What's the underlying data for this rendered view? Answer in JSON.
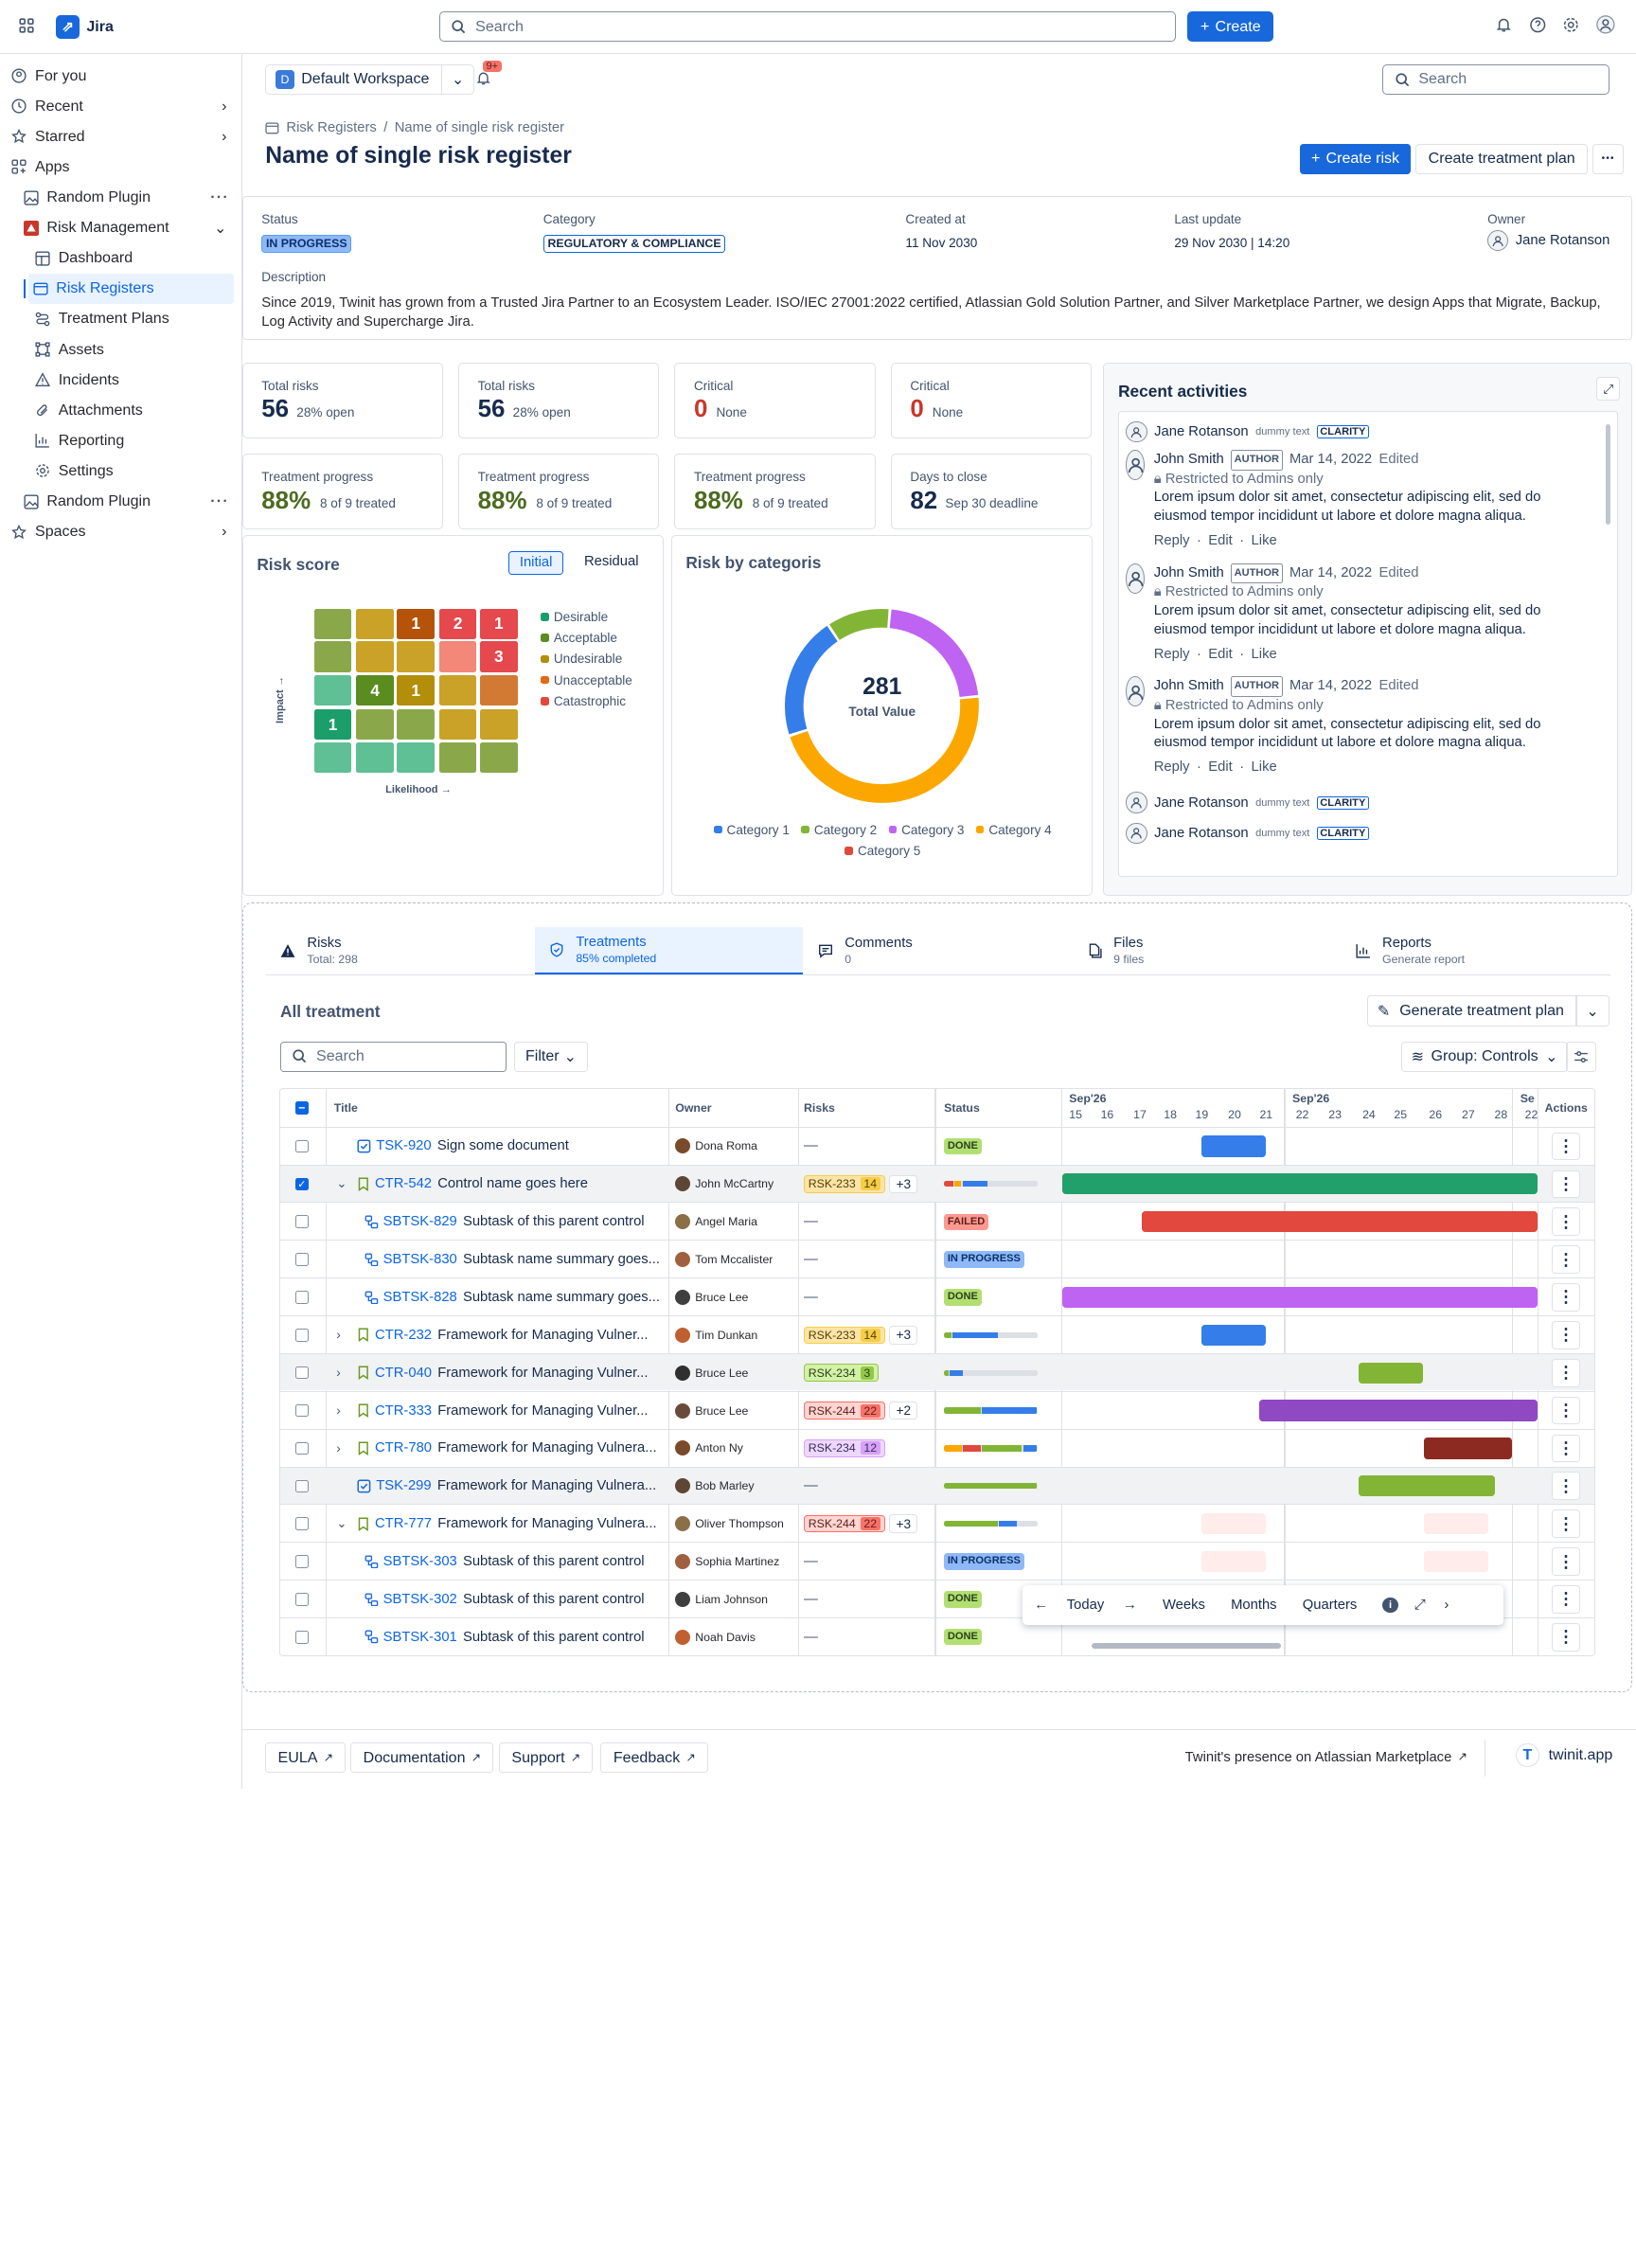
{
  "topbar": {
    "app_name": "Jira",
    "search_placeholder": "Search",
    "create_label": "Create"
  },
  "sidebar": {
    "items": [
      {
        "label": "For you"
      },
      {
        "label": "Recent"
      },
      {
        "label": "Starred"
      },
      {
        "label": "Apps"
      },
      {
        "label": "Random Plugin"
      },
      {
        "label": "Risk Management"
      },
      {
        "label": "Dashboard"
      },
      {
        "label": "Risk Registers"
      },
      {
        "label": "Treatment Plans"
      },
      {
        "label": "Assets"
      },
      {
        "label": "Incidents"
      },
      {
        "label": "Attachments"
      },
      {
        "label": "Reporting"
      },
      {
        "label": "Settings"
      },
      {
        "label": "Random Plugin"
      },
      {
        "label": "Spaces"
      }
    ]
  },
  "workspace": {
    "letter": "D",
    "name": "Default Workspace",
    "notif_badge": "9+",
    "search_placeholder": "Search"
  },
  "breadcrumb": {
    "root": "Risk Registers",
    "sep": "/",
    "current": "Name of single risk register"
  },
  "page": {
    "title": "Name of single risk register",
    "create_risk": "Create risk",
    "create_plan": "Create treatment plan",
    "more": "•••"
  },
  "details": {
    "status_label": "Status",
    "status": "IN PROGRESS",
    "category_label": "Category",
    "category": "REGULATORY & COMPLIANCE",
    "created_label": "Created at",
    "created": "11 Nov 2030",
    "updated_label": "Last update",
    "updated": "29 Nov 2030 | 14:20",
    "owner_label": "Owner",
    "owner": "Jane Rotanson",
    "desc_label": "Description",
    "desc": "Since 2019, Twinit has grown from a Trusted Jira Partner to an Ecosystem Leader. ISO/IEC 27001:2022 certified, Atlassian Gold Solution Partner, and Silver Marketplace Partner, we design Apps that Migrate, Backup, Log Activity and Supercharge Jira."
  },
  "stats": [
    {
      "label": "Total risks",
      "value": "56",
      "sub": "28% open"
    },
    {
      "label": "Total risks",
      "value": "56",
      "sub": "28% open"
    },
    {
      "label": "Critical",
      "value": "0",
      "sub": "None"
    },
    {
      "label": "Critical",
      "value": "0",
      "sub": "None"
    },
    {
      "label": "Treatment progress",
      "value": "88%",
      "sub": "8 of 9 treated"
    },
    {
      "label": "Treatment progress",
      "value": "88%",
      "sub": "8 of 9 treated"
    },
    {
      "label": "Treatment progress",
      "value": "88%",
      "sub": "8 of 9 treated"
    },
    {
      "label": "Days to close",
      "value": "82",
      "sub": "Sep 30 deadline"
    }
  ],
  "risk_score": {
    "title": "Risk score",
    "tab_initial": "Initial",
    "tab_residual": "Residual",
    "y_label": "Impact",
    "x_label": "Likelihood",
    "legend": [
      "Desirable",
      "Acceptable",
      "Undesirable",
      "Unacceptable",
      "Catastrophic"
    ],
    "cell_counts": [
      "1",
      "2",
      "1",
      "3",
      "4",
      "1",
      "1"
    ]
  },
  "risk_categories": {
    "title": "Risk by categoris",
    "center_value": "281",
    "center_label": "Total Value",
    "legend": [
      "Category 1",
      "Category 2",
      "Category 3",
      "Category 4",
      "Category 5"
    ]
  },
  "chart_data": {
    "type": "pie",
    "title": "Risk by categoris",
    "categories": [
      "Category 1",
      "Category 2",
      "Category 3",
      "Category 4",
      "Category 5"
    ],
    "values": [
      58,
      30,
      62,
      131,
      0
    ],
    "colors": [
      "#357de8",
      "#82b536",
      "#bf63f3",
      "#fca700",
      "#e2483d"
    ],
    "total": 281
  },
  "activities": {
    "title": "Recent activities",
    "entries": [
      {
        "name": "Jane Rotanson",
        "note": "dummy text",
        "tag": "CLARITY"
      },
      {
        "name": "John Smith",
        "role": "AUTHOR",
        "date": "Mar 14, 2022",
        "edited": "Edited",
        "restricted": "Restricted to Admins only",
        "body": "Lorem ipsum dolor sit amet, consectetur adipiscing elit, sed do eiusmod tempor incididunt ut labore et dolore magna aliqua.",
        "reply": "Reply",
        "edit": "Edit",
        "like": "Like"
      },
      {
        "name": "John Smith",
        "role": "AUTHOR",
        "date": "Mar 14, 2022",
        "edited": "Edited",
        "restricted": "Restricted to Admins only",
        "body": "Lorem ipsum dolor sit amet, consectetur adipiscing elit, sed do eiusmod tempor incididunt ut labore et dolore magna aliqua.",
        "reply": "Reply",
        "edit": "Edit",
        "like": "Like"
      },
      {
        "name": "John Smith",
        "role": "AUTHOR",
        "date": "Mar 14, 2022",
        "edited": "Edited",
        "restricted": "Restricted to Admins only",
        "body": "Lorem ipsum dolor sit amet, consectetur adipiscing elit, sed do eiusmod tempor incididunt ut labore et dolore magna aliqua.",
        "reply": "Reply",
        "edit": "Edit",
        "like": "Like"
      },
      {
        "name": "Jane Rotanson",
        "note": "dummy text",
        "tag": "CLARITY"
      },
      {
        "name": "Jane Rotanson",
        "note": "dummy text",
        "tag": "CLARITY"
      }
    ]
  },
  "tabs": [
    {
      "title": "Risks",
      "sub": "Total: 298"
    },
    {
      "title": "Treatments",
      "sub": "85% completed"
    },
    {
      "title": "Comments",
      "sub": "0"
    },
    {
      "title": "Files",
      "sub": "9 files"
    },
    {
      "title": "Reports",
      "sub": "Generate report"
    }
  ],
  "treatment": {
    "title": "All treatment",
    "generate": "Generate treatment plan",
    "search_placeholder": "Search",
    "filter": "Filter",
    "group": "Group: Controls",
    "columns": {
      "title": "Title",
      "owner": "Owner",
      "risks": "Risks",
      "status": "Status",
      "actions": "Actions"
    },
    "months": [
      "Sep'26",
      "Sep'26",
      "Se"
    ],
    "days": [
      "15",
      "16",
      "17",
      "18",
      "19",
      "20",
      "21",
      "22",
      "23",
      "24",
      "25",
      "26",
      "27",
      "28",
      "22"
    ],
    "rows": [
      {
        "key": "TSK-920",
        "title": "Sign some document",
        "owner": "Dona Roma",
        "risk": "—",
        "status": "DONE"
      },
      {
        "key": "CTR-542",
        "title": "Control name goes here",
        "owner": "John McCartny",
        "risk": "RSK-233",
        "risk_n": "14",
        "plus": "+3",
        "progress": [
          0.1,
          0.08,
          0.28,
          0.54
        ]
      },
      {
        "key": "SBTSK-829",
        "title": "Subtask of this parent control",
        "owner": "Angel Maria",
        "risk": "—",
        "status": "FAILED"
      },
      {
        "key": "SBTSK-830",
        "title": "Subtask name summary goes...",
        "owner": "Tom Mccalister",
        "risk": "—",
        "status": "IN PROGRESS"
      },
      {
        "key": "SBTSK-828",
        "title": "Subtask name summary goes...",
        "owner": "Bruce Lee",
        "risk": "—",
        "status": "DONE"
      },
      {
        "key": "CTR-232",
        "title": "Framework for Managing Vulner...",
        "owner": "Tim Dunkan",
        "risk": "RSK-233",
        "risk_n": "14",
        "plus": "+3",
        "progress": [
          0.08,
          0.5,
          0.42
        ]
      },
      {
        "key": "CTR-040",
        "title": "Framework for Managing Vulner...",
        "owner": "Bruce Lee",
        "risk": "RSK-234",
        "risk_n": "3",
        "progress": [
          0.05,
          0.15,
          0.8
        ]
      },
      {
        "key": "CTR-333",
        "title": "Framework for Managing Vulner...",
        "owner": "Bruce Lee",
        "risk": "RSK-244",
        "risk_n": "22",
        "plus": "+2",
        "progress": [
          0.4,
          0.6
        ]
      },
      {
        "key": "CTR-780",
        "title": "Framework for Managing Vulnera...",
        "owner": "Anton Ny",
        "risk": "RSK-234",
        "risk_n": "12",
        "progress": [
          0.2,
          0.2,
          0.45,
          0.15
        ]
      },
      {
        "key": "TSK-299",
        "title": "Framework for Managing Vulnera...",
        "owner": "Bob Marley",
        "risk": "—",
        "progress": [
          1.0
        ]
      },
      {
        "key": "CTR-777",
        "title": "Framework for Managing Vulnera...",
        "owner": "Oliver Thompson",
        "risk": "RSK-244",
        "risk_n": "22",
        "plus": "+3",
        "progress": [
          0.6,
          0.2,
          0.2
        ]
      },
      {
        "key": "SBTSK-303",
        "title": "Subtask of this parent control",
        "owner": "Sophia Martinez",
        "risk": "—",
        "status": "IN PROGRESS"
      },
      {
        "key": "SBTSK-302",
        "title": "Subtask of this parent control",
        "owner": "Liam Johnson",
        "risk": "—",
        "status": "DONE"
      },
      {
        "key": "SBTSK-301",
        "title": "Subtask of this parent control",
        "owner": "Noah Davis",
        "risk": "—",
        "status": "DONE"
      }
    ],
    "timeline_nav": {
      "today": "Today",
      "weeks": "Weeks",
      "months": "Months",
      "quarters": "Quarters"
    }
  },
  "footer": {
    "eula": "EULA",
    "docs": "Documentation",
    "support": "Support",
    "feedback": "Feedback",
    "marketplace": "Twinit's presence on Atlassian Marketplace",
    "site": "twinit.app"
  }
}
